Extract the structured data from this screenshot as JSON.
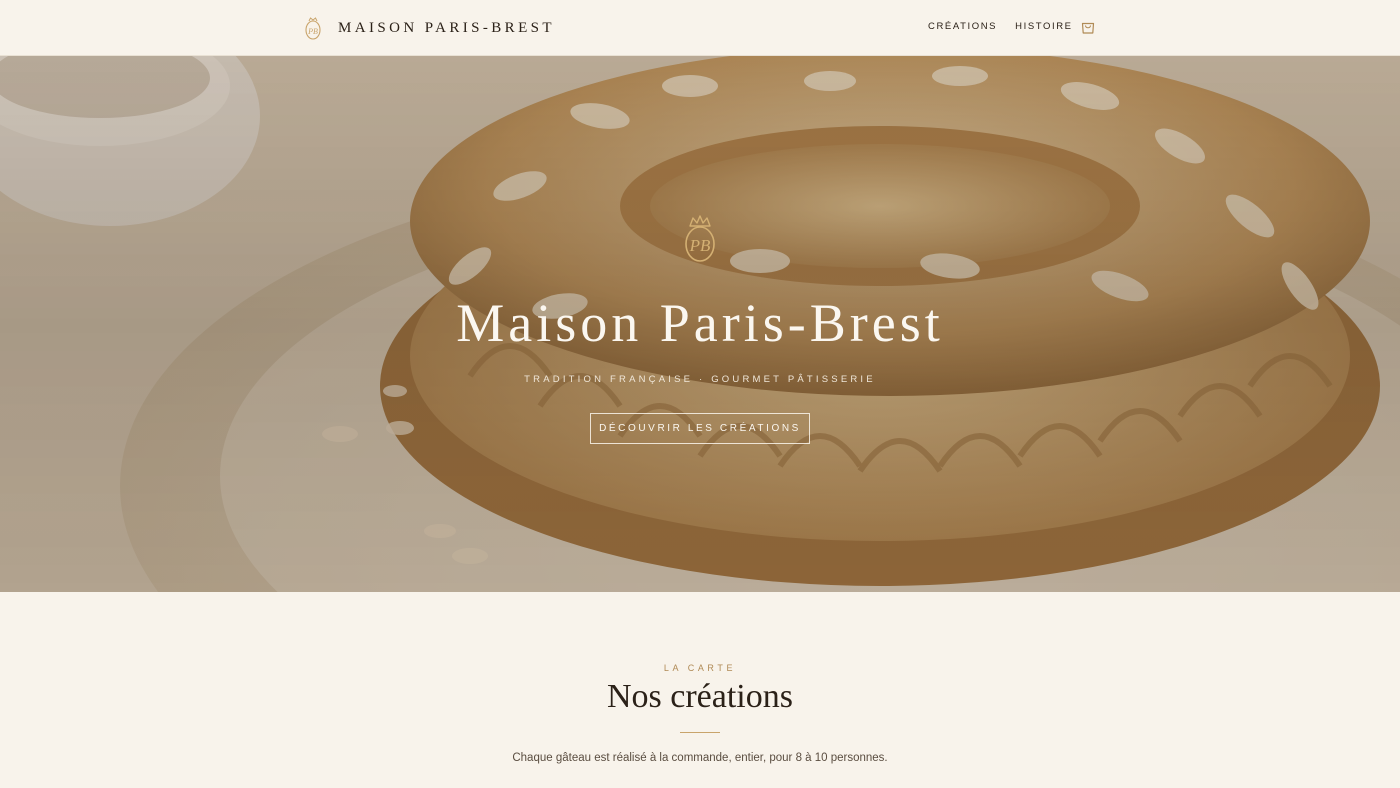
{
  "header": {
    "brand_name": "MAISON PARIS-BREST",
    "nav": [
      {
        "label": "CRÉATIONS"
      },
      {
        "label": "HISTOIRE"
      }
    ]
  },
  "hero": {
    "title": "Maison Paris-Brest",
    "subtitle": "TRADITION FRANÇAISE · GOURMET PÂTISSERIE",
    "cta_label": "DÉCOUVRIR LES CRÉATIONS"
  },
  "menu_section": {
    "eyebrow": "LA CARTE",
    "title": "Nos créations",
    "description": "Chaque gâteau est réalisé à la commande, entier, pour 8 à 10 personnes."
  },
  "icons": {
    "logo": "pb-crest-icon",
    "cart": "shopping-bag-icon",
    "hero_emblem": "pb-crown-crest-icon"
  },
  "colors": {
    "background": "#f8f3eb",
    "accent_gold": "#c9a46b",
    "text_dark": "#2b2118"
  }
}
